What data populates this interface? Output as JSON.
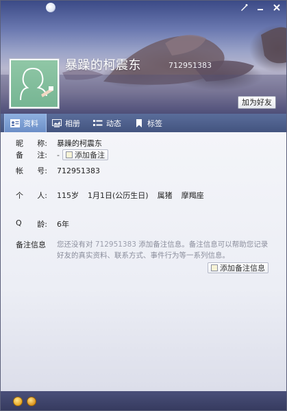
{
  "header": {
    "nickname": "暴躁的柯震东",
    "qq_number": "712951383",
    "add_friend_label": "加为好友",
    "controls": [
      "brush-icon",
      "minimize-icon",
      "close-icon"
    ]
  },
  "tabs": [
    {
      "label": "资料",
      "icon": "profile-card-icon",
      "active": true
    },
    {
      "label": "相册",
      "icon": "album-icon",
      "active": false
    },
    {
      "label": "动态",
      "icon": "feed-icon",
      "active": false
    },
    {
      "label": "标签",
      "icon": "bookmark-icon",
      "active": false
    }
  ],
  "profile": {
    "nickname_label": [
      "昵",
      "称:"
    ],
    "nickname_value": "暴躁的柯震东",
    "remark_label": [
      "备",
      "注:"
    ],
    "remark_value": "-",
    "remark_add_label": "添加备注",
    "account_label": [
      "帐",
      "号:"
    ],
    "account_value": "712951383",
    "personal_label": [
      "个",
      "人:"
    ],
    "personal": [
      "115岁",
      "1月1日(公历生日)",
      "属猪",
      "摩羯座"
    ],
    "qage_label": [
      "Q",
      "龄:"
    ],
    "qage_value": "6年",
    "remark_info_label": "备注信息",
    "remark_info_pre": "您还没有对 ",
    "remark_info_num": "712951383",
    "remark_info_post": " 添加备注信息。备注信息可以帮助您记录好友的真实资料、联系方式、事件行为等一系列信息。",
    "remark_info_add_label": "添加备注信息"
  },
  "colors": {
    "tabbar": "#43547f",
    "tab_active": "#7c9ed3",
    "bottom_bar": "#3d4268",
    "hint_text": "#8b8e9c"
  }
}
